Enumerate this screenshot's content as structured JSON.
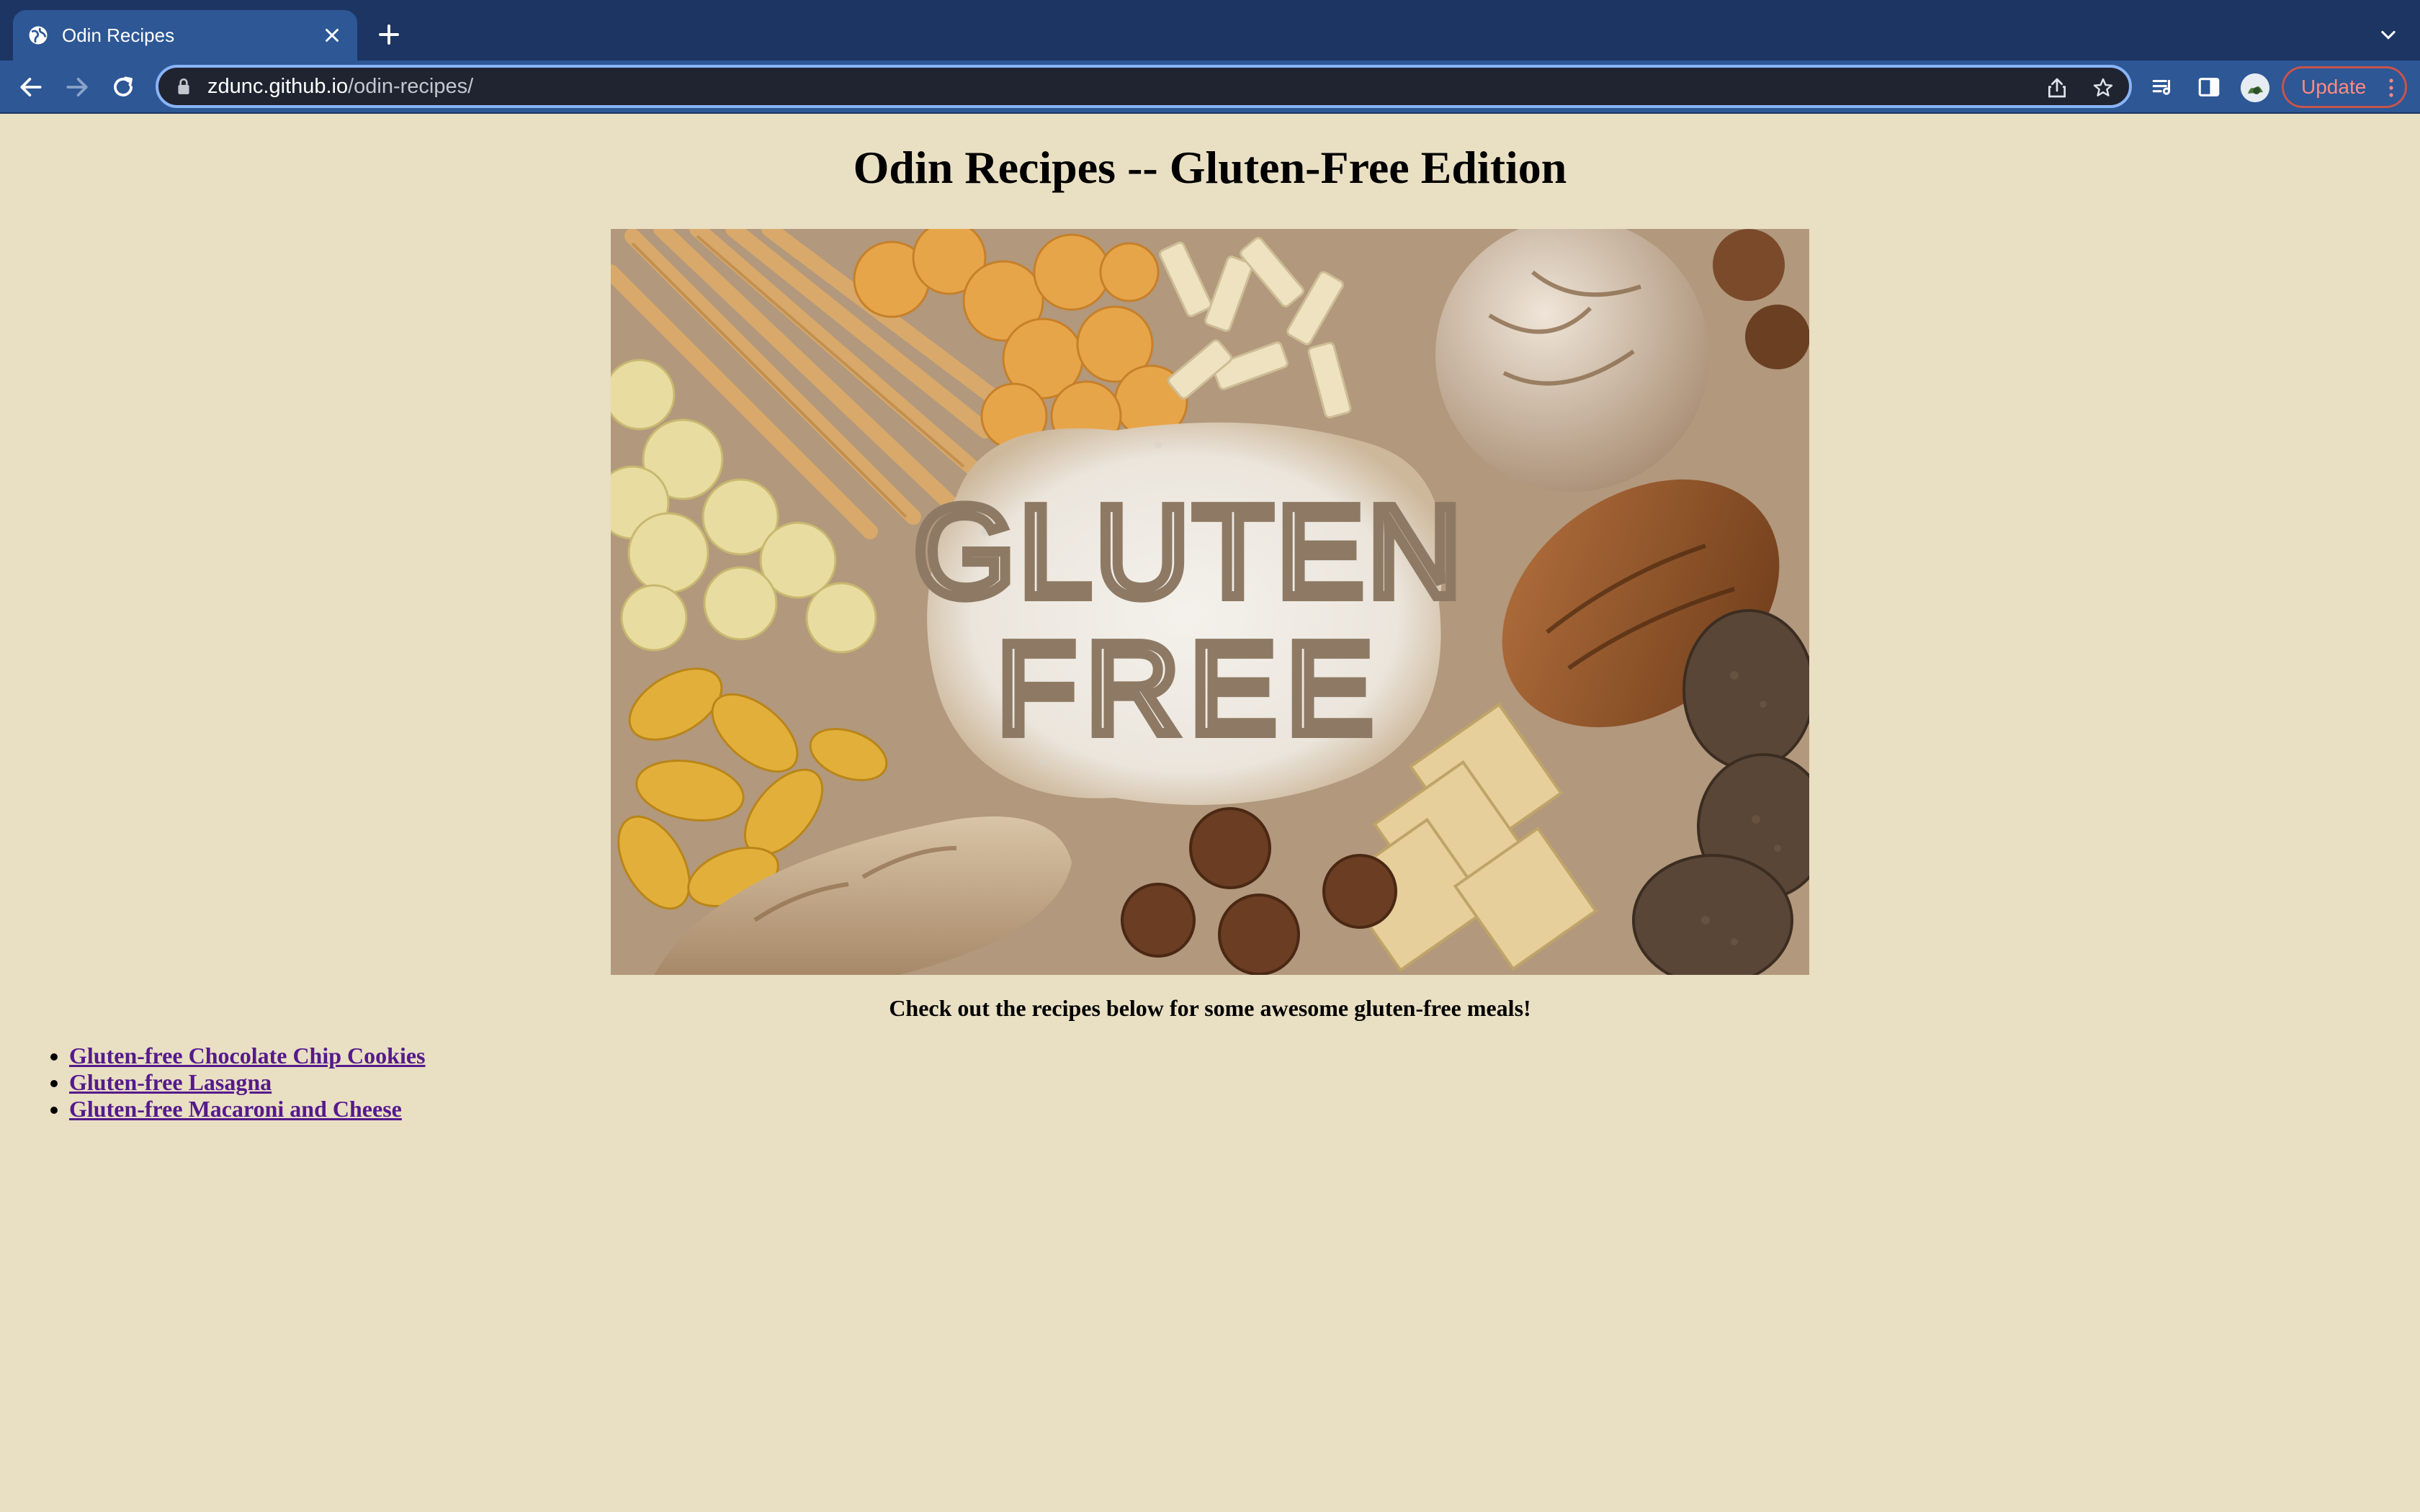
{
  "browser": {
    "tab": {
      "title": "Odin Recipes",
      "icon": "globe-icon"
    },
    "address_bar": {
      "host": "zdunc.github.io",
      "path": "/odin-recipes/"
    },
    "update_button_label": "Update",
    "colors": {
      "tab_strip": "#1d3563",
      "active_tab": "#2d5795",
      "omnibox_focus": "#8ab4f8",
      "update_accent": "#ff8a80"
    }
  },
  "page": {
    "background": "#e9dfc3",
    "title": "Odin Recipes -- Gluten-Free Edition",
    "hero_image": {
      "word1": "GLUTEN",
      "word2": "FREE"
    },
    "tagline": "Check out the recipes below for some awesome gluten-free meals!",
    "recipes": [
      {
        "label": "Gluten-free Chocolate Chip Cookies"
      },
      {
        "label": "Gluten-free Lasagna"
      },
      {
        "label": "Gluten-free Macaroni and Cheese"
      }
    ],
    "link_color": "#551a8b"
  }
}
